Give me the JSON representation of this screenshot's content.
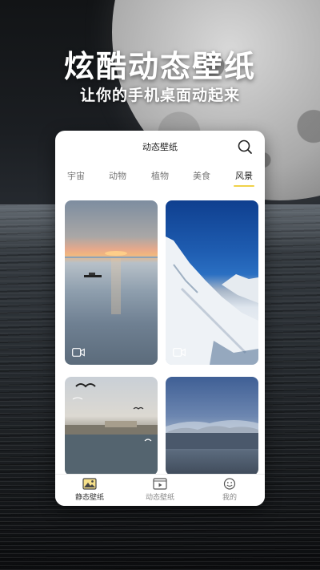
{
  "promo": {
    "title": "炫酷动态壁纸",
    "subtitle": "让你的手机桌面动起来"
  },
  "app": {
    "title": "动态壁纸",
    "search_icon": "search-icon",
    "tabs": [
      {
        "label": "宇宙"
      },
      {
        "label": "动物"
      },
      {
        "label": "植物"
      },
      {
        "label": "美食"
      },
      {
        "label": "风景",
        "active": true
      }
    ],
    "accent_color": "#f0d24a",
    "wallpapers": [
      {
        "icon": "video-icon"
      },
      {
        "icon": "video-icon"
      },
      {},
      {}
    ],
    "bottom_nav": [
      {
        "label": "静态壁纸",
        "icon": "image-icon",
        "active": true
      },
      {
        "label": "动态壁纸",
        "icon": "play-video-icon"
      },
      {
        "label": "我的",
        "icon": "smiley-face-icon"
      }
    ]
  }
}
